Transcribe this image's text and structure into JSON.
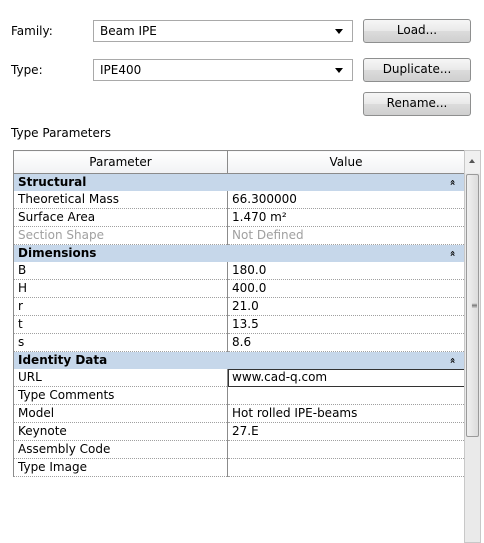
{
  "family": {
    "label": "Family:",
    "value": "Beam IPE"
  },
  "type": {
    "label": "Type:",
    "value": "IPE400"
  },
  "buttons": {
    "load": "Load...",
    "duplicate": "Duplicate...",
    "rename": "Rename..."
  },
  "section_title": "Type Parameters",
  "grid": {
    "headers": {
      "parameter": "Parameter",
      "value": "Value"
    },
    "collapse_glyph": "»",
    "groups": [
      {
        "name": "Structural",
        "rows": [
          {
            "param": "Theoretical Mass",
            "value": "66.300000"
          },
          {
            "param": "Surface Area",
            "value": "1.470 m²"
          },
          {
            "param": "Section Shape",
            "value": "Not Defined",
            "disabled": true
          }
        ]
      },
      {
        "name": "Dimensions",
        "rows": [
          {
            "param": "B",
            "value": "180.0"
          },
          {
            "param": "H",
            "value": "400.0"
          },
          {
            "param": "r",
            "value": "21.0"
          },
          {
            "param": "t",
            "value": "13.5"
          },
          {
            "param": "s",
            "value": "8.6"
          }
        ]
      },
      {
        "name": "Identity Data",
        "rows": [
          {
            "param": "URL",
            "value": "www.cad-q.com",
            "editing": true
          },
          {
            "param": "Type Comments",
            "value": ""
          },
          {
            "param": "Model",
            "value": "Hot rolled IPE-beams"
          },
          {
            "param": "Keynote",
            "value": "27.E"
          },
          {
            "param": "Assembly Code",
            "value": ""
          },
          {
            "param": "Type Image",
            "value": ""
          }
        ]
      }
    ]
  },
  "scrollbar": {
    "grip": "≡"
  }
}
